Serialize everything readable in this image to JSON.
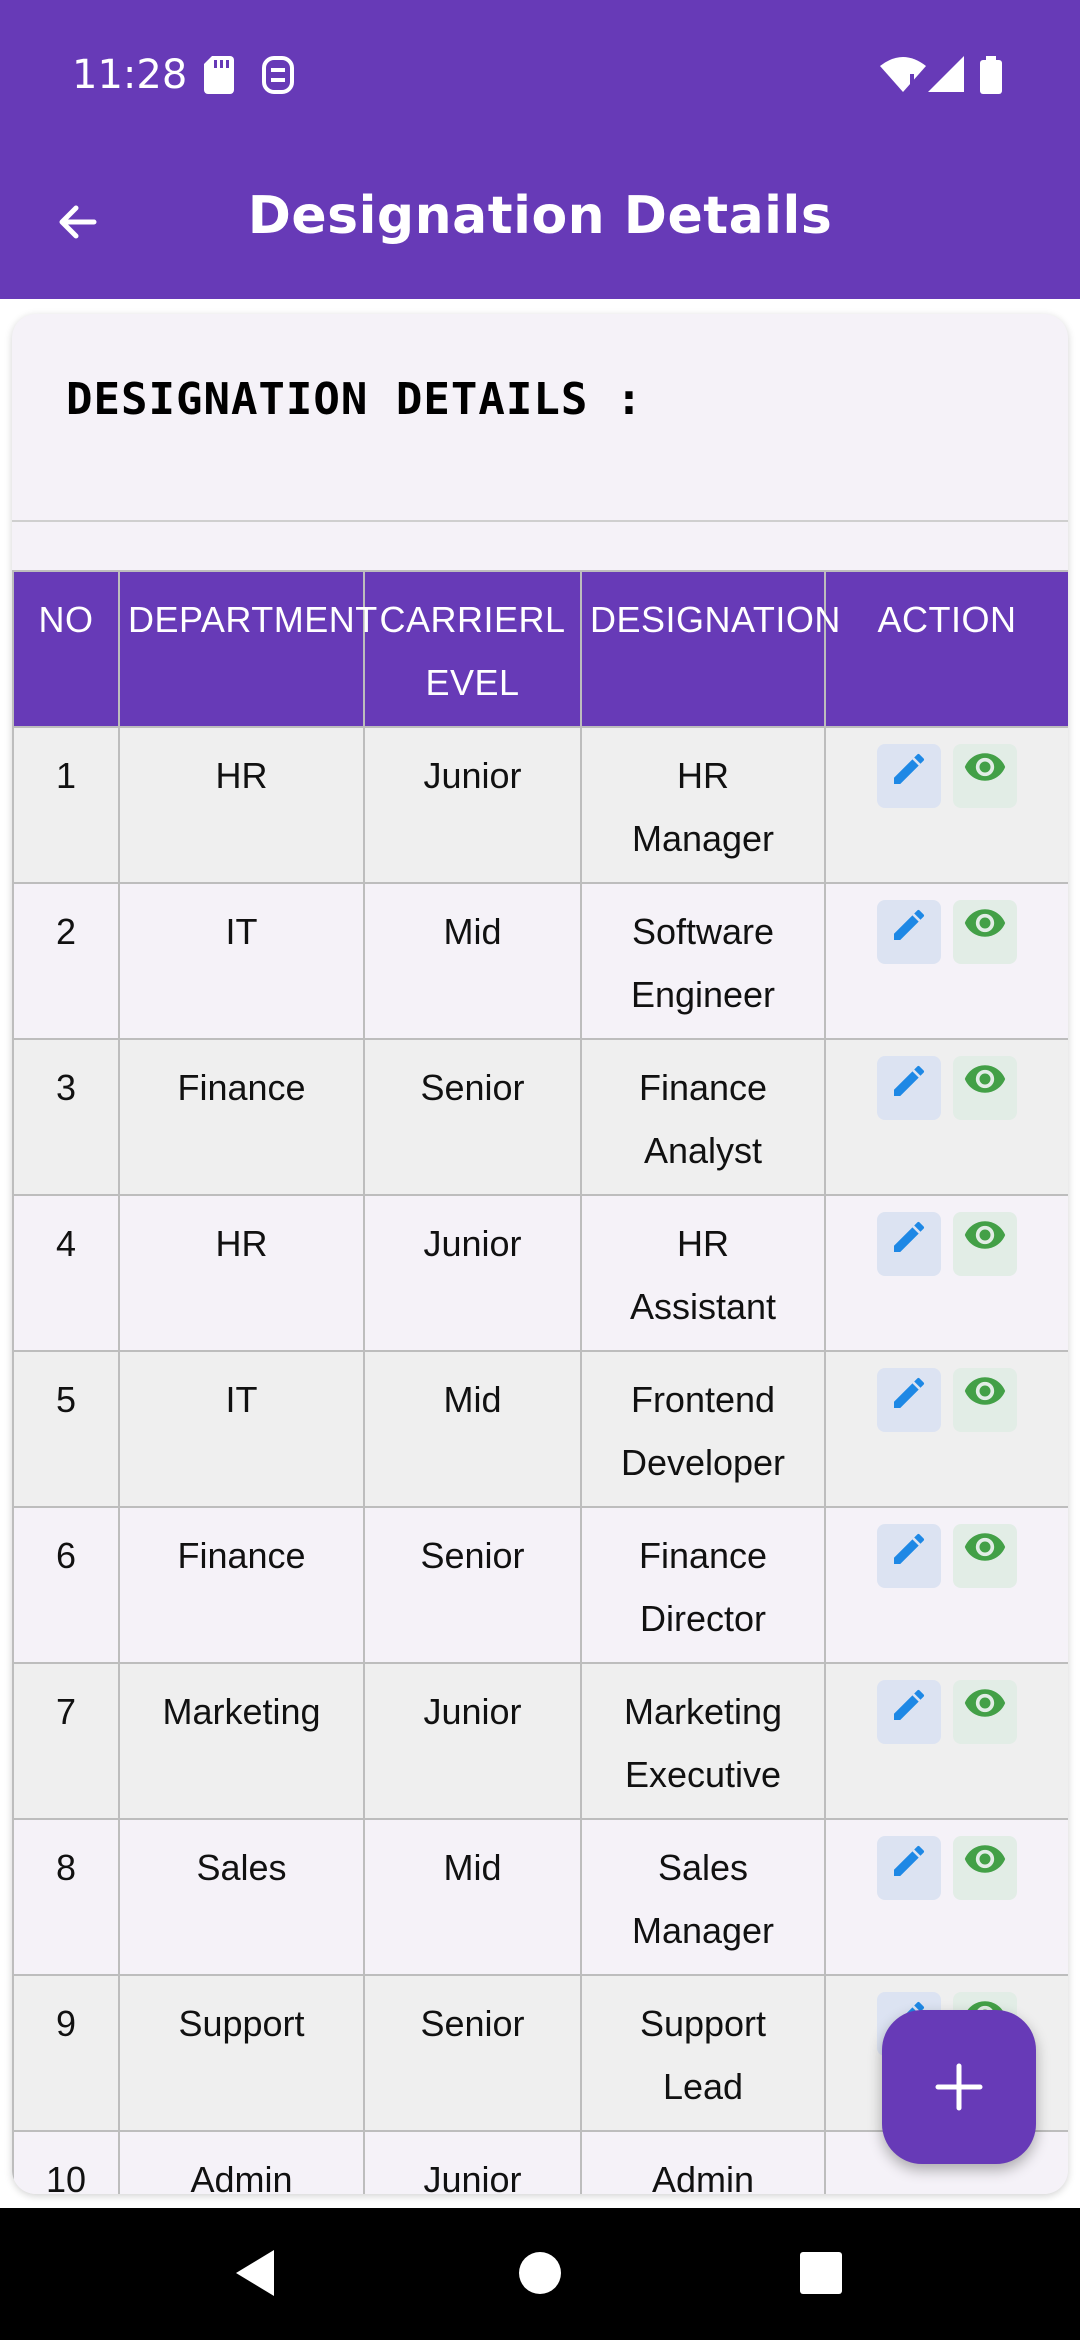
{
  "status": {
    "time": "11:28"
  },
  "appbar": {
    "title": "Designation Details",
    "back_icon": "arrow-left-icon"
  },
  "card": {
    "title": "DESIGNATION DETAILS :"
  },
  "table": {
    "headers": {
      "no": "NO",
      "department": "DEPARTMENT",
      "level": "CARRIERLEVEL",
      "designation": "DESIGNATION",
      "action": "ACTION"
    },
    "rows": [
      {
        "no": "1",
        "department": "HR",
        "level": "Junior",
        "designation": "HR Manager"
      },
      {
        "no": "2",
        "department": "IT",
        "level": "Mid",
        "designation": "Software Engineer"
      },
      {
        "no": "3",
        "department": "Finance",
        "level": "Senior",
        "designation": "Finance Analyst"
      },
      {
        "no": "4",
        "department": "HR",
        "level": "Junior",
        "designation": "HR Assistant"
      },
      {
        "no": "5",
        "department": "IT",
        "level": "Mid",
        "designation": "Frontend Developer"
      },
      {
        "no": "6",
        "department": "Finance",
        "level": "Senior",
        "designation": "Finance Director"
      },
      {
        "no": "7",
        "department": "Marketing",
        "level": "Junior",
        "designation": "Marketing Executive"
      },
      {
        "no": "8",
        "department": "Sales",
        "level": "Mid",
        "designation": "Sales Manager"
      },
      {
        "no": "9",
        "department": "Support",
        "level": "Senior",
        "designation": "Support Lead"
      },
      {
        "no": "10",
        "department": "Admin",
        "level": "Junior",
        "designation": "Admin Executive"
      }
    ]
  },
  "colors": {
    "primary": "#673AB7",
    "edit": "#1E88E5",
    "view": "#43A047"
  },
  "fab": {
    "icon": "plus-icon"
  },
  "navbar": {
    "icons": [
      "back-triangle-icon",
      "home-circle-icon",
      "recents-square-icon"
    ]
  }
}
